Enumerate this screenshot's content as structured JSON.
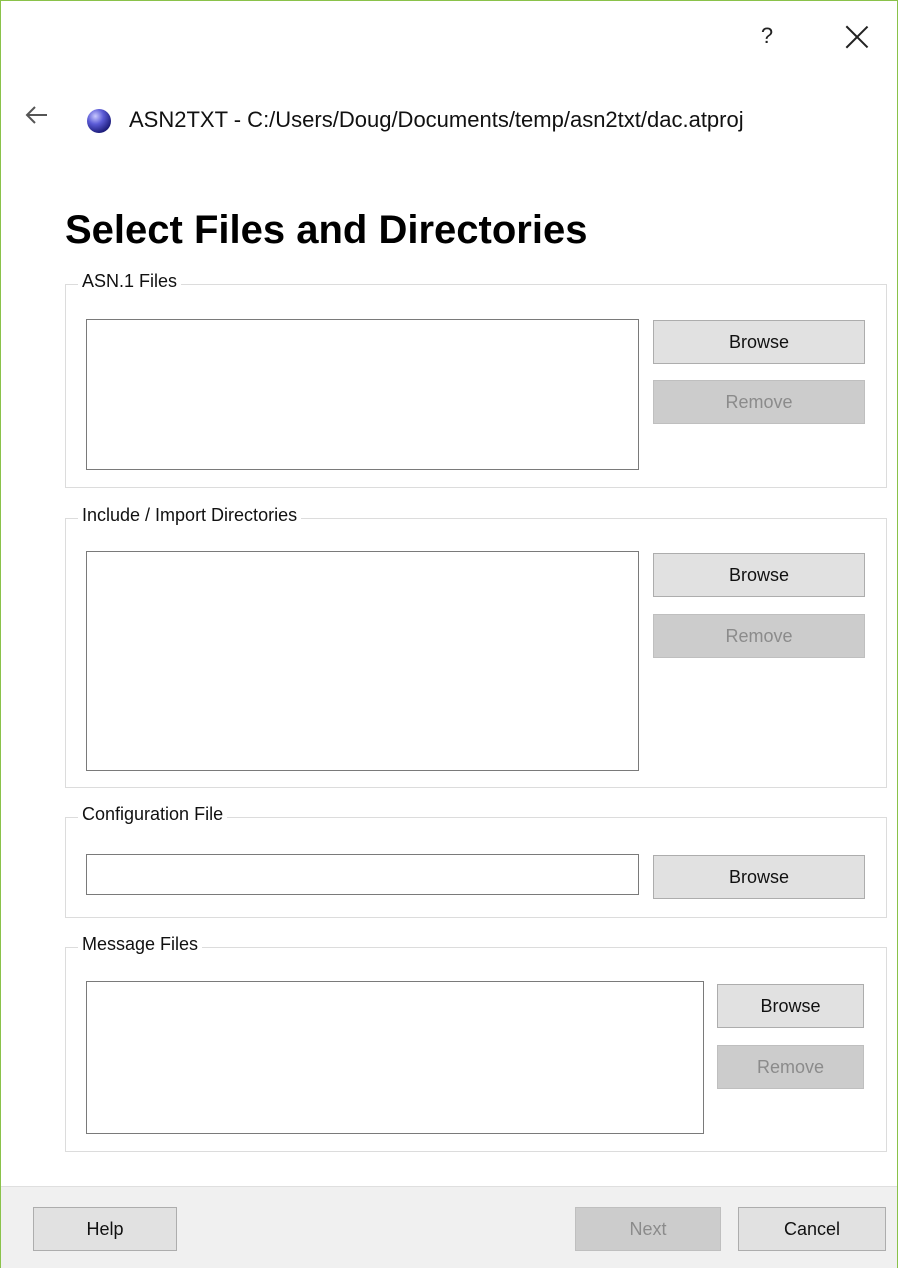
{
  "window": {
    "help_symbol": "?",
    "app_title": "ASN2TXT - C:/Users/Doug/Documents/temp/asn2txt/dac.atproj",
    "accent_border_color": "#8ac24a",
    "icons": {
      "help": "question-mark-icon",
      "close": "close-icon",
      "back": "back-arrow-icon",
      "app": "app-globe-icon"
    }
  },
  "page": {
    "title": "Select Files and Directories"
  },
  "groups": {
    "asn1_files": {
      "label": "ASN.1 Files",
      "browse_label": "Browse",
      "remove_label": "Remove"
    },
    "include_dirs": {
      "label": "Include / Import Directories",
      "browse_label": "Browse",
      "remove_label": "Remove"
    },
    "config_file": {
      "label": "Configuration File",
      "value": "",
      "browse_label": "Browse"
    },
    "message_files": {
      "label": "Message Files",
      "browse_label": "Browse",
      "remove_label": "Remove"
    }
  },
  "footer": {
    "help_label": "Help",
    "next_label": "Next",
    "cancel_label": "Cancel"
  }
}
